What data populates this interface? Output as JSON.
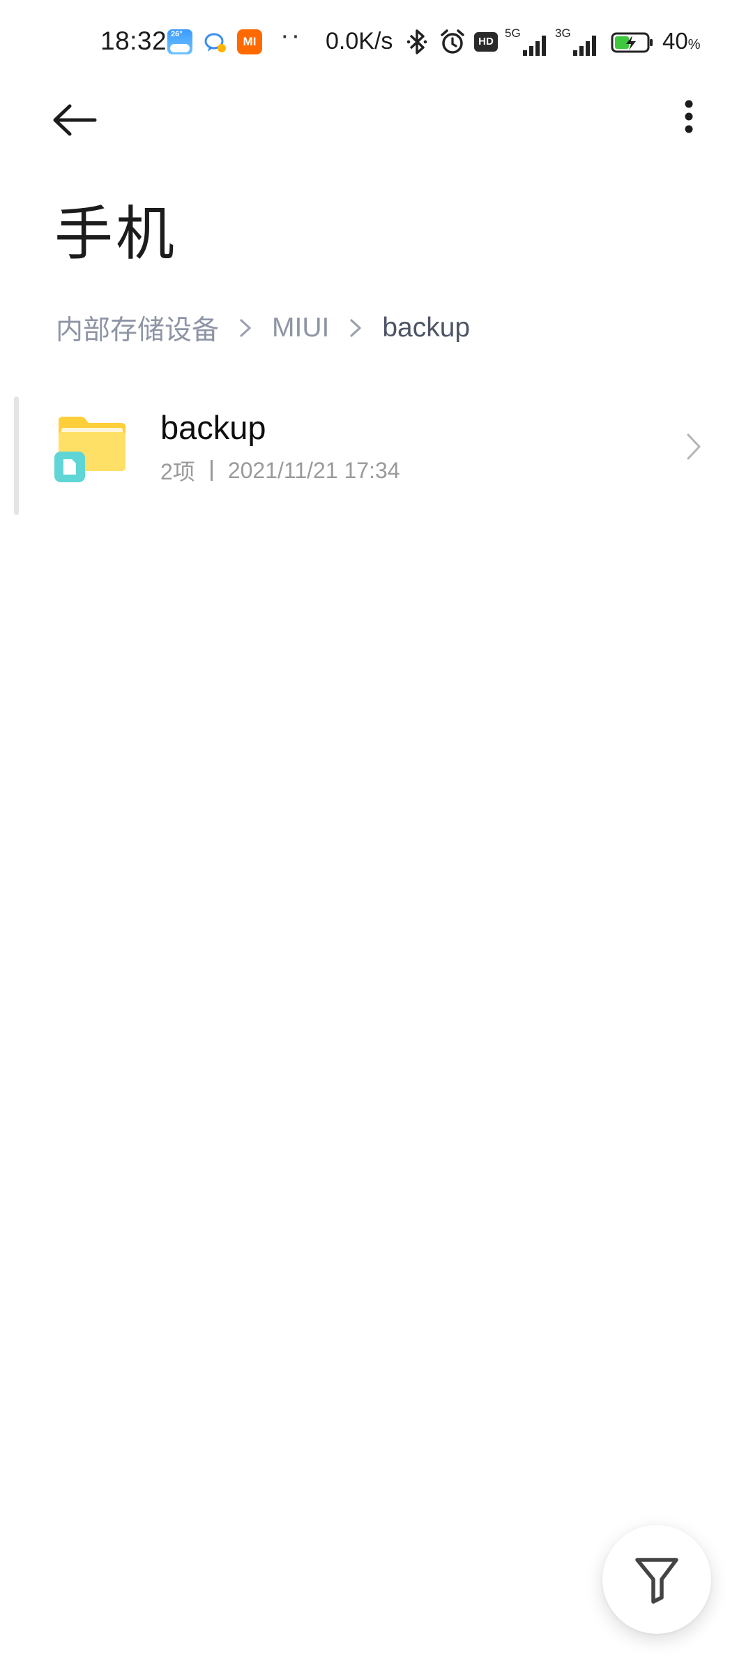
{
  "status_bar": {
    "time": "18:32",
    "weather_temp": "26°",
    "mi_label": "MI",
    "overflow_dots": "··",
    "net_speed": "0.0K/s",
    "hd_label": "HD",
    "signal1_type": "5G",
    "signal2_type": "3G",
    "battery_percent": "40",
    "battery_unit": "%"
  },
  "toolbar": {
    "back_icon": "arrow-left-icon",
    "more_icon": "more-vertical-icon"
  },
  "page": {
    "title": "手机"
  },
  "breadcrumb": {
    "items": [
      "内部存储设备",
      "MIUI",
      "backup"
    ]
  },
  "files": [
    {
      "name": "backup",
      "item_count": "2项",
      "modified": "2021/11/21 17:34",
      "icon": "folder-icon"
    }
  ],
  "fab": {
    "icon": "filter-icon"
  },
  "colors": {
    "breadcrumb_inactive": "#8e95a5",
    "breadcrumb_active": "#4d5566",
    "folder_yellow": "#ffd84a",
    "folder_badge": "#5fd5d5",
    "mi_orange": "#ff6a00",
    "battery_green": "#3ec83e"
  }
}
